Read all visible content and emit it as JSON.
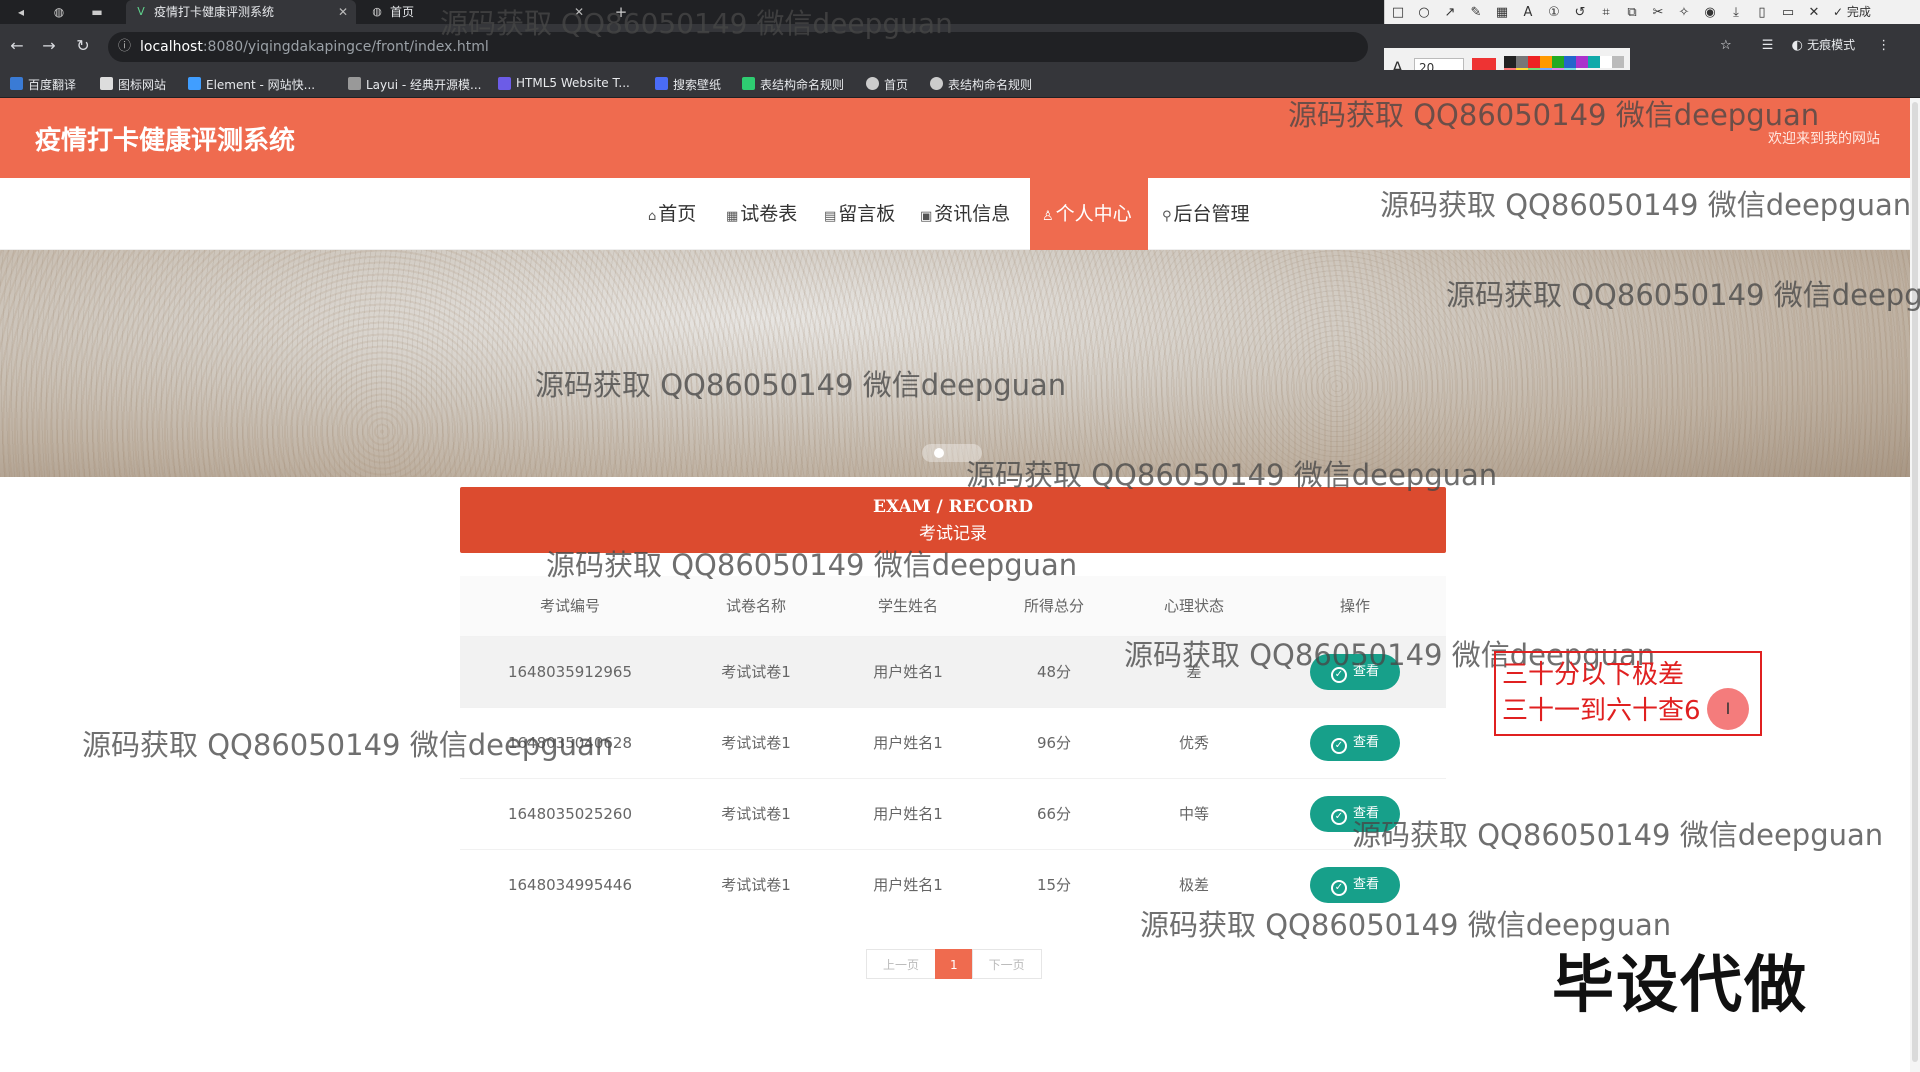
{
  "browser": {
    "tabs": [
      {
        "title": "疫情打卡健康评测系统",
        "icon": "vue-icon"
      },
      {
        "title": "首页",
        "icon": "globe-icon"
      }
    ],
    "new_tab": "+",
    "url_host": "localhost",
    "url_path": ":8080/yiqingdakapingce/front/index.html",
    "profile_label": "无痕模式",
    "bookmarks": [
      "百度翻译",
      "图标网站",
      "Element - 网站快...",
      "Layui - 经典开源模...",
      "HTML5 Website T...",
      "搜索壁纸",
      "表结构命名规则",
      "首页",
      "表结构命名规则"
    ],
    "annotation_tool": {
      "font_size": "20",
      "done_label": "完成",
      "main_color": "#ee3333"
    }
  },
  "site": {
    "title": "疫情打卡健康评测系统",
    "welcome": "欢迎来到我的网站",
    "nav": [
      {
        "label": "首页",
        "icon": "⌂"
      },
      {
        "label": "试卷表",
        "icon": "▦"
      },
      {
        "label": "留言板",
        "icon": "▤"
      },
      {
        "label": "资讯信息",
        "icon": "▣"
      },
      {
        "label": "个人中心",
        "icon": "♙"
      },
      {
        "label": "后台管理",
        "icon": "⚲"
      }
    ],
    "active_nav": "个人中心",
    "accent": "#ef6b4f"
  },
  "section": {
    "title_en": "EXAM / RECORD",
    "title_cn": "考试记录"
  },
  "table": {
    "headers": [
      "考试编号",
      "试卷名称",
      "学生姓名",
      "所得总分",
      "心理状态",
      "操作"
    ],
    "rows": [
      {
        "id": "1648035912965",
        "paper": "考试试卷1",
        "student": "用户姓名1",
        "score": "48分",
        "state": "差",
        "action": "查看"
      },
      {
        "id": "1648035040628",
        "paper": "考试试卷1",
        "student": "用户姓名1",
        "score": "96分",
        "state": "优秀",
        "action": "查看"
      },
      {
        "id": "1648035025260",
        "paper": "考试试卷1",
        "student": "用户姓名1",
        "score": "66分",
        "state": "中等",
        "action": "查看"
      },
      {
        "id": "1648034995446",
        "paper": "考试试卷1",
        "student": "用户姓名1",
        "score": "15分",
        "state": "极差",
        "action": "查看"
      }
    ]
  },
  "pager": {
    "prev": "上一页",
    "current": "1",
    "next": "下一页"
  },
  "overlay": {
    "watermark": "源码获取 QQ86050149 微信deepguan",
    "note_line1": "三十分以下极差",
    "note_line2": "三十一到六十查6",
    "stamp": "毕设代做"
  }
}
